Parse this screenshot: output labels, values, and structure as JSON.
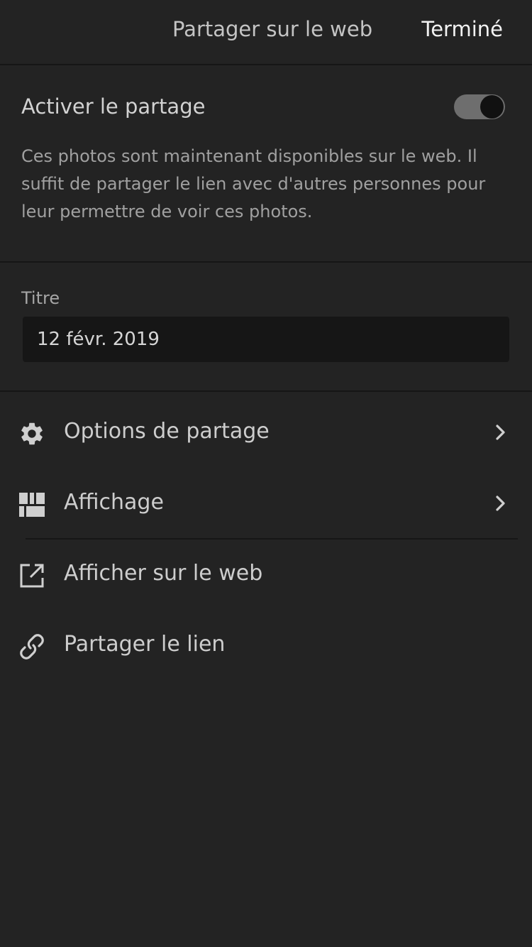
{
  "header": {
    "title": "Partager sur le web",
    "done_label": "Terminé"
  },
  "share": {
    "label": "Activer le partage",
    "enabled": true,
    "description": "Ces photos sont maintenant disponibles sur le web. Il suffit de partager le lien avec d'autres personnes pour leur permettre de voir ces photos."
  },
  "title_field": {
    "label": "Titre",
    "value": "12 févr. 2019"
  },
  "menu": {
    "items": [
      {
        "label": "Options de partage",
        "icon": "gear-icon",
        "has_chevron": true
      },
      {
        "label": "Affichage",
        "icon": "layout-grid-icon",
        "has_chevron": true
      },
      {
        "label": "Afficher sur le web",
        "icon": "external-link-icon",
        "has_chevron": false
      },
      {
        "label": "Partager le lien",
        "icon": "link-icon",
        "has_chevron": false
      }
    ]
  },
  "colors": {
    "background": "#232323",
    "divider": "#161616",
    "input_background": "#161616",
    "toggle_track": "#6e6e6e",
    "toggle_knob": "#111111"
  }
}
